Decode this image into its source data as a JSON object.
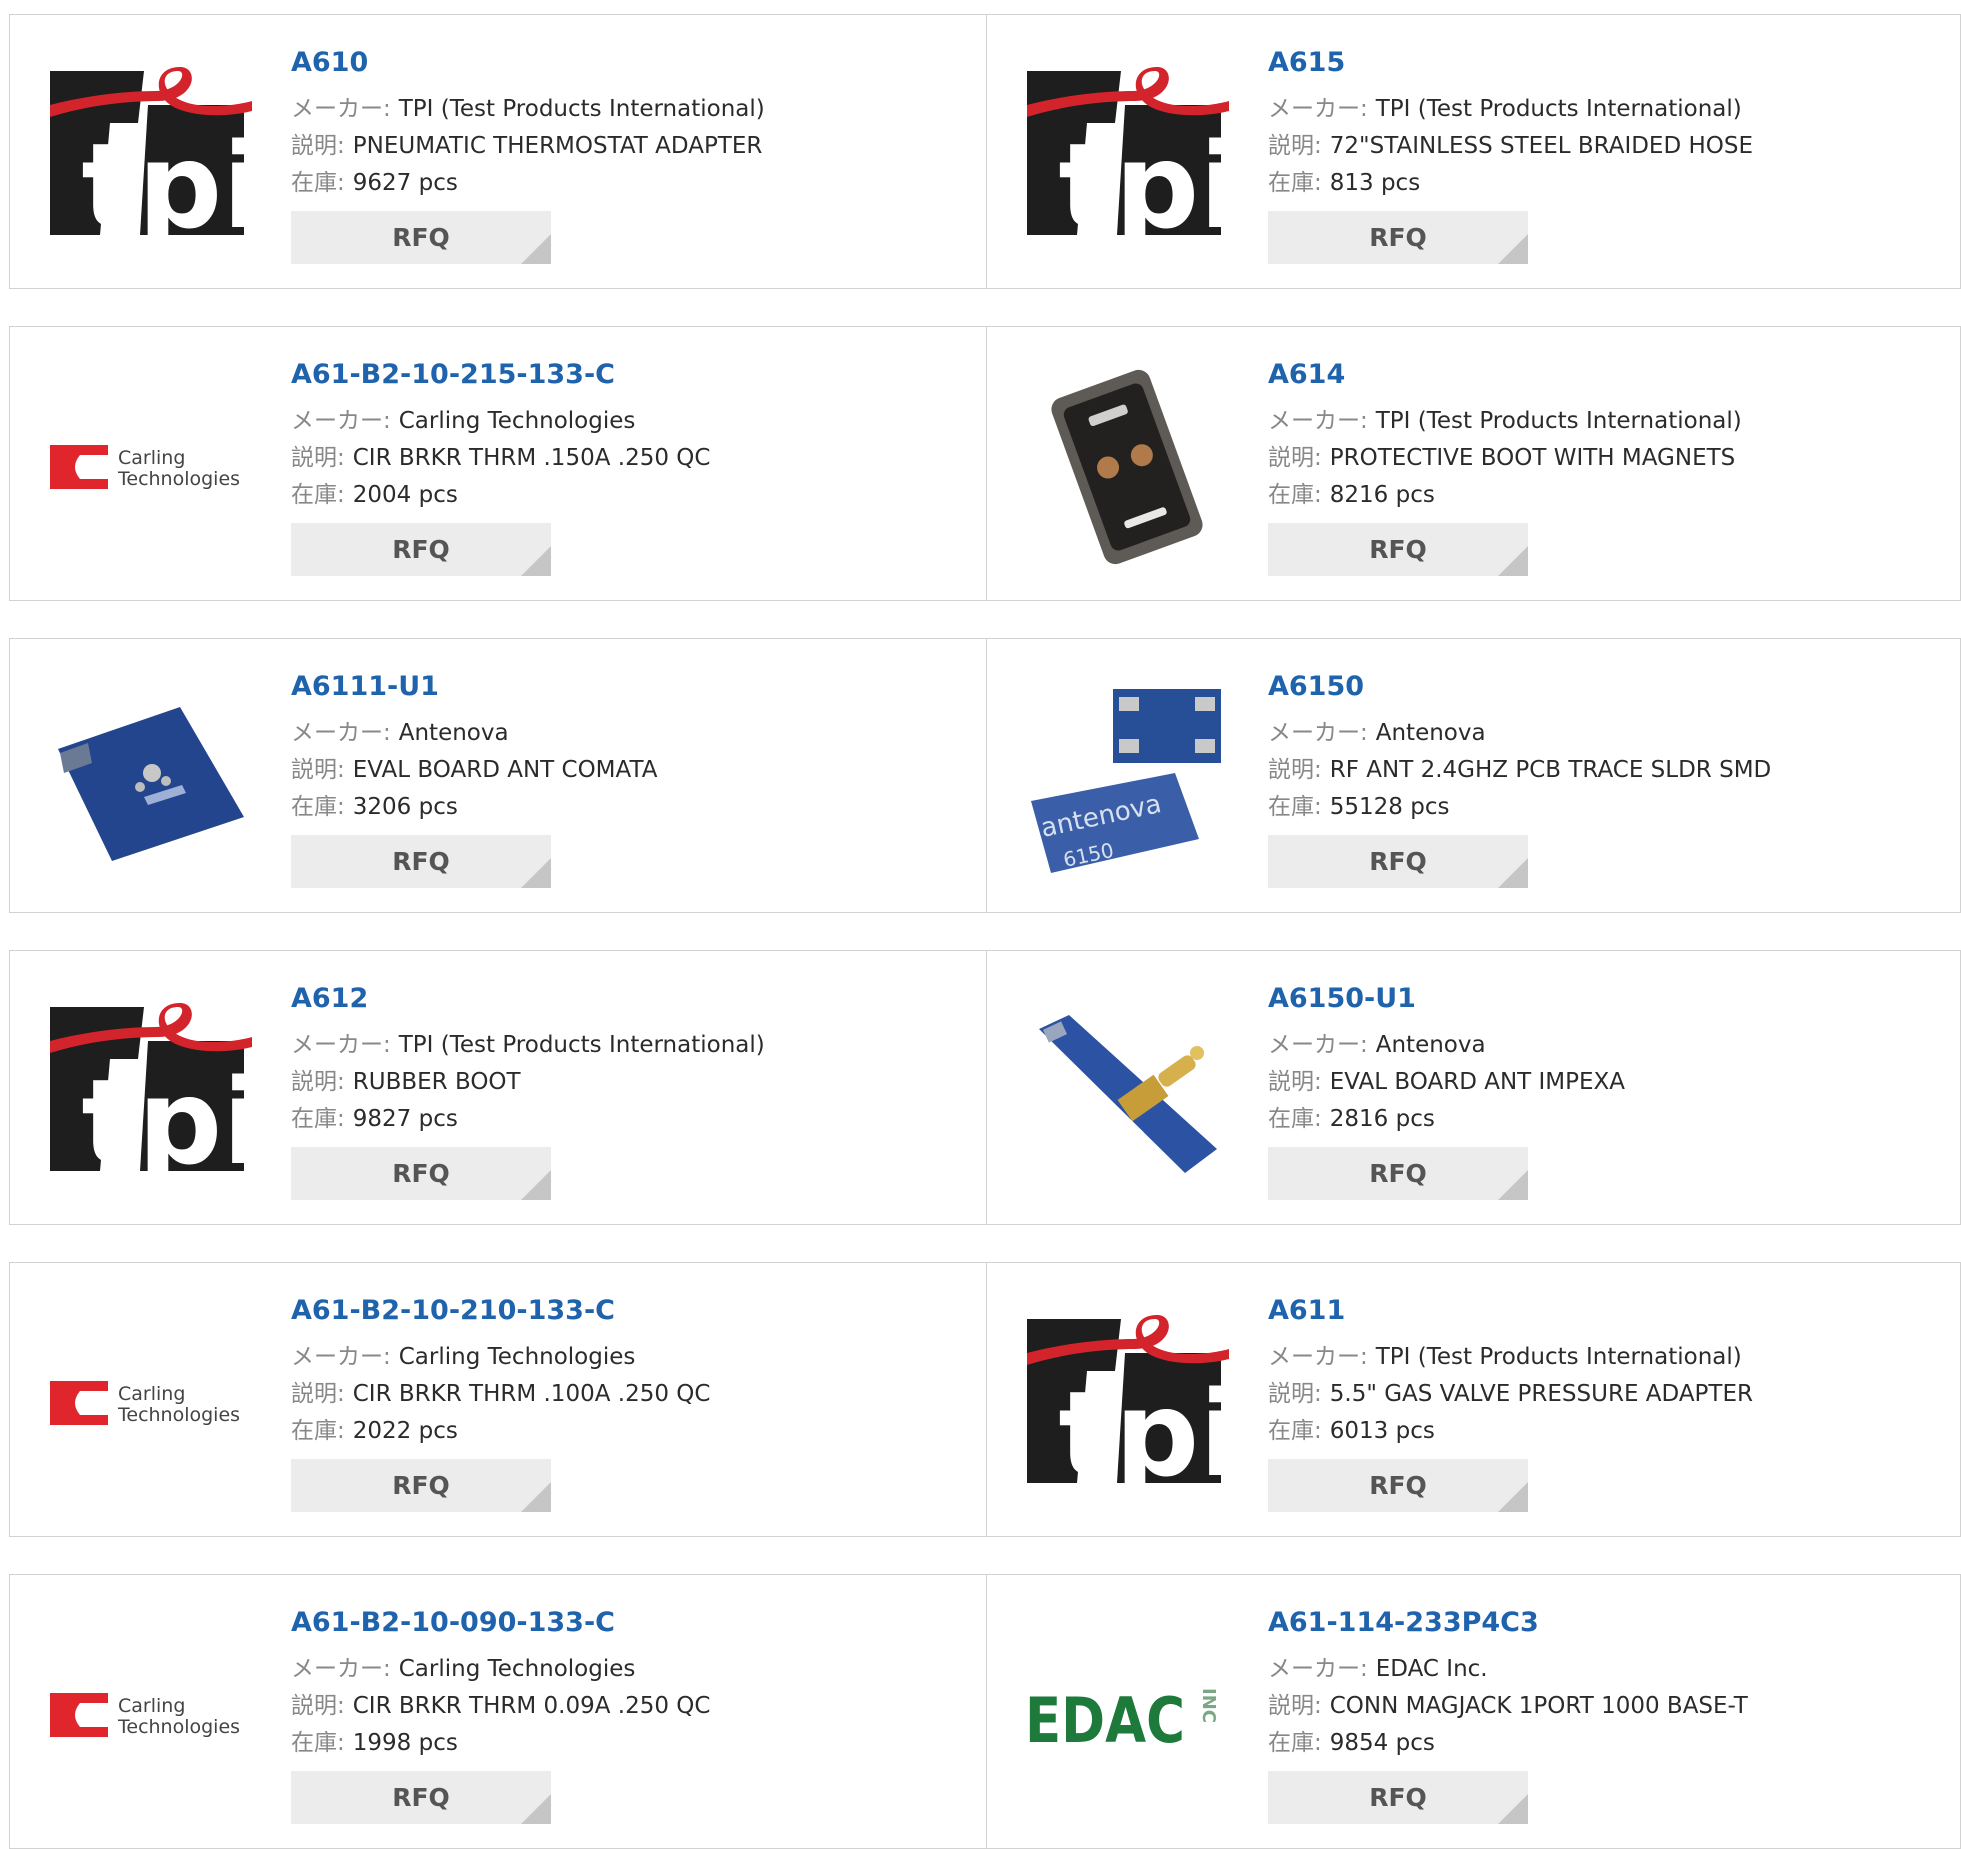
{
  "labels": {
    "maker": "メーカー:",
    "desc": "説明:",
    "stock": "在庫:",
    "rfq": "RFQ"
  },
  "logos": {
    "tpi": "tpi",
    "carling_line1": "Carling",
    "carling_line2": "Technologies",
    "antenova": "antenova",
    "antenova_code": "6150",
    "edac": "EDAC",
    "edac_suffix": "INC"
  },
  "colors": {
    "part_link": "#1f63ad",
    "rfq_bg": "#ececec",
    "tpi_red": "#d4242b",
    "carling_red": "#e0262c",
    "edac_green": "#1d7a3a"
  },
  "products": [
    {
      "part": "A610",
      "maker": "TPI (Test Products International)",
      "desc": "PNEUMATIC THERMOSTAT ADAPTER",
      "stock": "9627 pcs",
      "thumb": "tpi"
    },
    {
      "part": "A615",
      "maker": "TPI (Test Products International)",
      "desc": "72\"STAINLESS STEEL BRAIDED HOSE",
      "stock": "813 pcs",
      "thumb": "tpi"
    },
    {
      "part": "A61-B2-10-215-133-C",
      "maker": "Carling Technologies",
      "desc": "CIR BRKR THRM .150A .250 QC",
      "stock": "2004 pcs",
      "thumb": "carling"
    },
    {
      "part": "A614",
      "maker": "TPI (Test Products International)",
      "desc": "PROTECTIVE BOOT WITH MAGNETS",
      "stock": "8216 pcs",
      "thumb": "boot"
    },
    {
      "part": "A6111-U1",
      "maker": "Antenova",
      "desc": "EVAL BOARD ANT COMATA",
      "stock": "3206 pcs",
      "thumb": "board"
    },
    {
      "part": "A6150",
      "maker": "Antenova",
      "desc": "RF ANT 2.4GHZ PCB TRACE SLDR SMD",
      "stock": "55128 pcs",
      "thumb": "chip"
    },
    {
      "part": "A612",
      "maker": "TPI (Test Products International)",
      "desc": "RUBBER BOOT",
      "stock": "9827 pcs",
      "thumb": "tpi"
    },
    {
      "part": "A6150-U1",
      "maker": "Antenova",
      "desc": "EVAL BOARD ANT IMPEXA",
      "stock": "2816 pcs",
      "thumb": "evalsma"
    },
    {
      "part": "A61-B2-10-210-133-C",
      "maker": "Carling Technologies",
      "desc": "CIR BRKR THRM .100A .250 QC",
      "stock": "2022 pcs",
      "thumb": "carling"
    },
    {
      "part": "A611",
      "maker": "TPI (Test Products International)",
      "desc": "5.5\" GAS VALVE PRESSURE ADAPTER",
      "stock": "6013 pcs",
      "thumb": "tpi"
    },
    {
      "part": "A61-B2-10-090-133-C",
      "maker": "Carling Technologies",
      "desc": "CIR BRKR THRM 0.09A .250 QC",
      "stock": "1998 pcs",
      "thumb": "carling"
    },
    {
      "part": "A61-114-233P4C3",
      "maker": "EDAC Inc.",
      "desc": "CONN MAGJACK 1PORT 1000 BASE-T",
      "stock": "9854 pcs",
      "thumb": "edac"
    }
  ]
}
